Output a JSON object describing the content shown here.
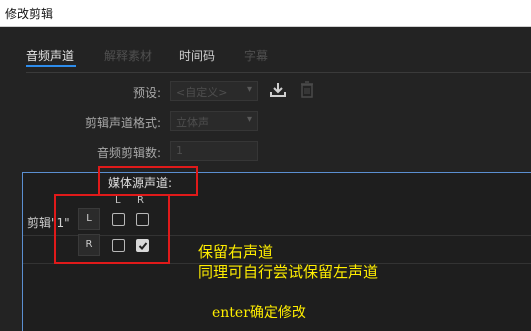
{
  "window": {
    "title": "修改剪辑"
  },
  "tabs": [
    {
      "label": "音频声道",
      "state": "active"
    },
    {
      "label": "解释素材",
      "state": "disabled"
    },
    {
      "label": "时间码",
      "state": "normal"
    },
    {
      "label": "字幕",
      "state": "disabled"
    }
  ],
  "form": {
    "preset_label": "预设:",
    "preset_value": "<自定义>",
    "format_label": "剪辑声道格式:",
    "format_value": "立体声",
    "count_label": "音频剪辑数:",
    "count_value": "1"
  },
  "channels": {
    "header": "媒体源声道:",
    "col_left": "L",
    "col_right": "R",
    "clip_label": "剪辑\"1\"",
    "row_left": "L",
    "row_right": "R",
    "checks": {
      "L_L": false,
      "L_R": false,
      "R_L": false,
      "R_R": true
    }
  },
  "annotations": {
    "line1": "保留右声道",
    "line2": "同理可自行尝试保留左声道",
    "line3": "enter确定修改"
  },
  "colors": {
    "accent": "#2d8ceb",
    "highlight_box": "#e01a1a",
    "annotation_text": "#ffee00"
  },
  "icons": [
    "save-preset-icon",
    "delete-preset-icon",
    "checkmark-icon"
  ]
}
